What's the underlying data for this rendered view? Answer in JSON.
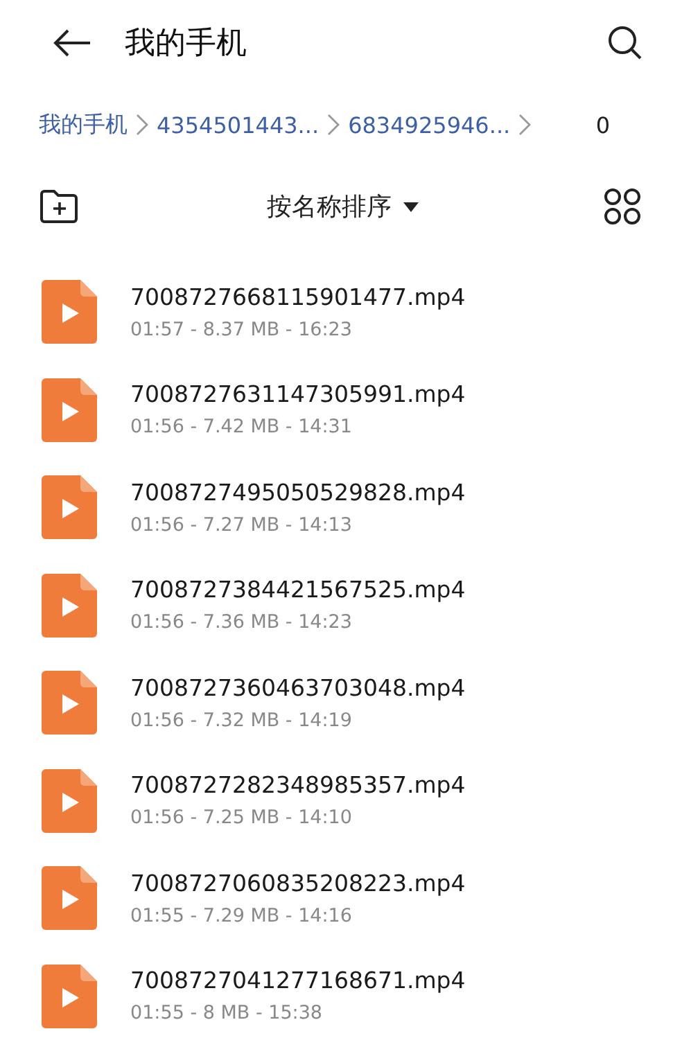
{
  "header": {
    "title": "我的手机"
  },
  "breadcrumb": {
    "items": [
      {
        "label": "我的手机"
      },
      {
        "label": "4354501443..."
      },
      {
        "label": "6834925946..."
      }
    ],
    "count": "0"
  },
  "toolbar": {
    "sort_label": "按名称排序"
  },
  "files": [
    {
      "name": "7008727668115901477.mp4",
      "meta": "01:57 - 8.37 MB - 16:23"
    },
    {
      "name": "7008727631147305991.mp4",
      "meta": "01:56 - 7.42 MB - 14:31"
    },
    {
      "name": "7008727495050529828.mp4",
      "meta": "01:56 - 7.27 MB - 14:13"
    },
    {
      "name": "7008727384421567525.mp4",
      "meta": "01:56 - 7.36 MB - 14:23"
    },
    {
      "name": "7008727360463703048.mp4",
      "meta": "01:56 - 7.32 MB - 14:19"
    },
    {
      "name": "7008727282348985357.mp4",
      "meta": "01:56 - 7.25 MB - 14:10"
    },
    {
      "name": "7008727060835208223.mp4",
      "meta": "01:55 - 7.29 MB - 14:16"
    },
    {
      "name": "7008727041277168671.mp4",
      "meta": "01:55 - 8 MB - 15:38"
    }
  ]
}
